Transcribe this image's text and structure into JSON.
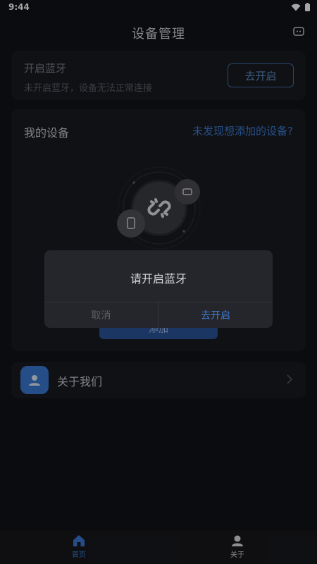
{
  "status_bar": {
    "time": "9:44"
  },
  "header": {
    "title": "设备管理",
    "chat_icon": "chat-bubble-icon"
  },
  "bluetooth_card": {
    "title": "开启蓝牙",
    "description": "未开启蓝牙，设备无法正常连接",
    "button_label": "去开启"
  },
  "devices_card": {
    "title": "我的设备",
    "help_link": "未发现想添加的设备?",
    "add_button_label": "添加"
  },
  "about_card": {
    "label": "关于我们"
  },
  "tabbar": {
    "tabs": [
      {
        "label": "首页",
        "icon": "home-icon",
        "active": true
      },
      {
        "label": "关于",
        "icon": "person-icon",
        "active": false
      }
    ]
  },
  "dialog": {
    "message": "请开启蓝牙",
    "cancel_label": "取消",
    "confirm_label": "去开启"
  },
  "colors": {
    "background": "#121318",
    "card": "#1a1b21",
    "accent": "#3d7bd1",
    "dialog": "#25262c"
  }
}
